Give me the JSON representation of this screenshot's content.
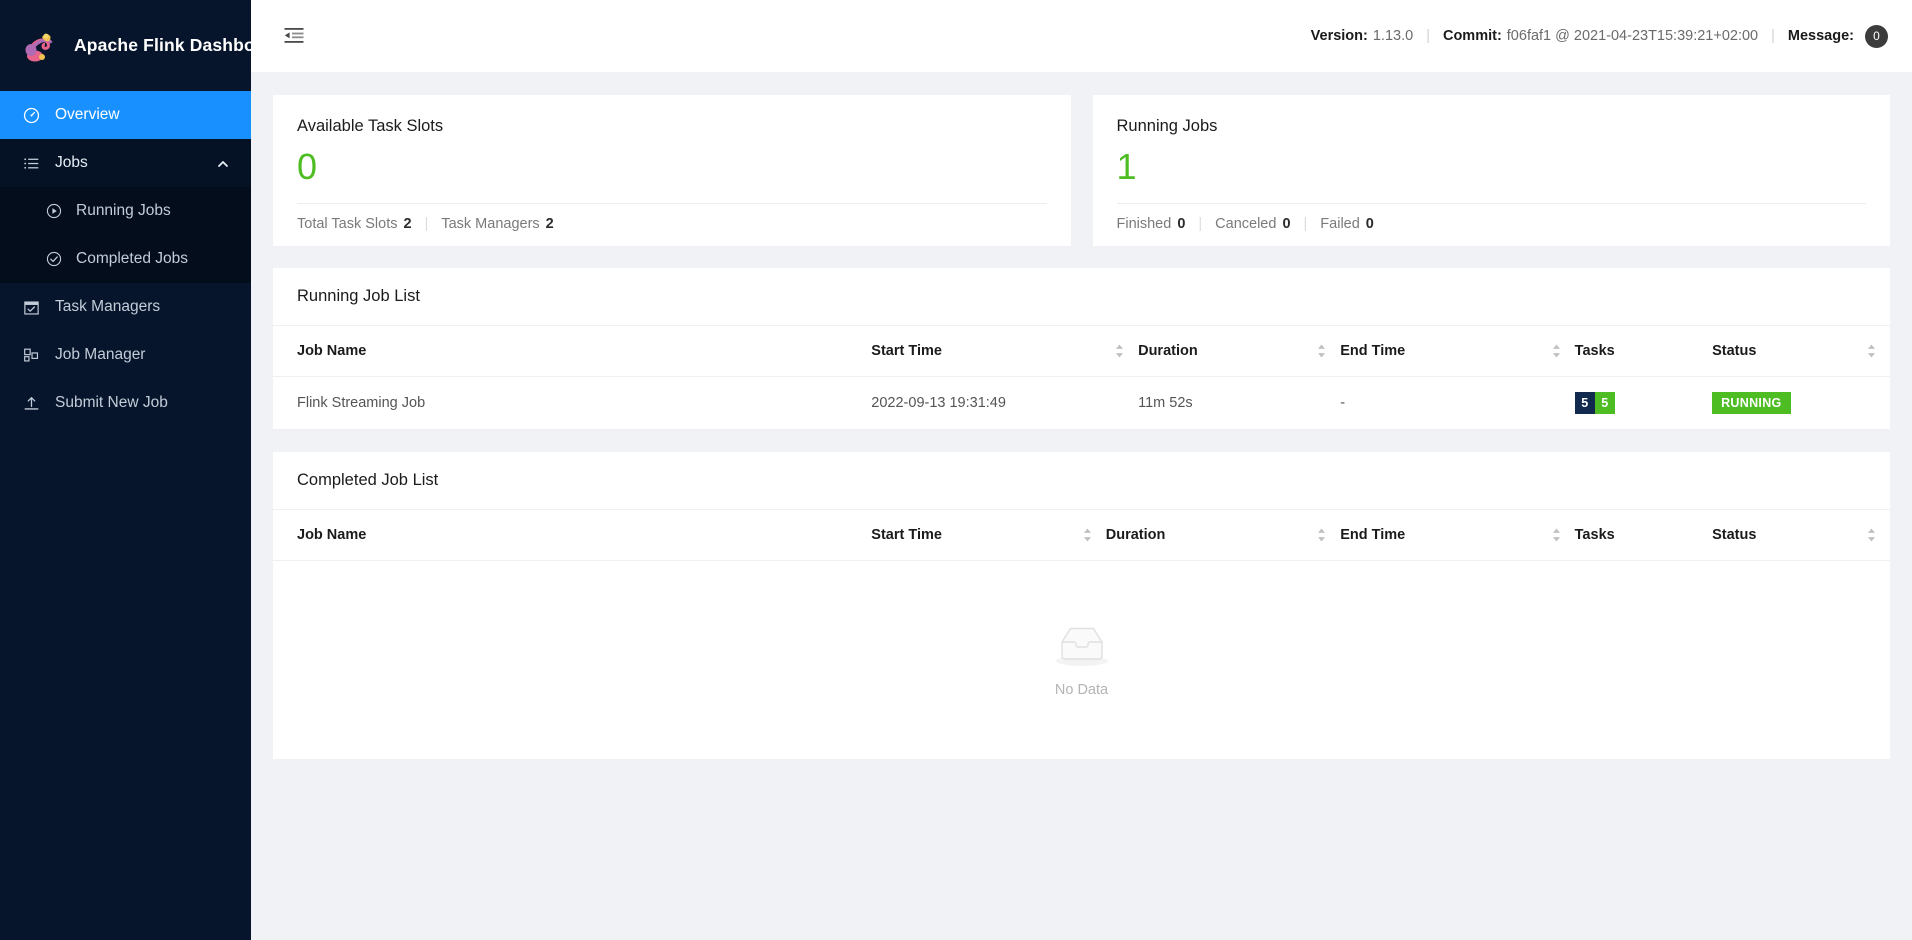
{
  "brand": {
    "title": "Apache Flink Dashboard",
    "logo_icon": "flink-squirrel-logo"
  },
  "sidebar": {
    "items": [
      {
        "label": "Overview",
        "icon": "dashboard-gauge-icon",
        "active": true
      },
      {
        "label": "Jobs",
        "icon": "list-icon",
        "expanded": true,
        "chevron": "chevron-up-icon"
      },
      {
        "label": "Task Managers",
        "icon": "calendar-check-icon",
        "active": false
      },
      {
        "label": "Job Manager",
        "icon": "cluster-grid-icon",
        "active": false
      },
      {
        "label": "Submit New Job",
        "icon": "upload-icon",
        "active": false
      }
    ],
    "sub_items": [
      {
        "label": "Running Jobs",
        "icon": "play-circle-icon"
      },
      {
        "label": "Completed Jobs",
        "icon": "check-circle-icon"
      }
    ]
  },
  "topbar": {
    "fold_icon": "menu-fold-icon",
    "version_label": "Version:",
    "version_value": "1.13.0",
    "commit_label": "Commit:",
    "commit_value": "f06faf1 @ 2021-04-23T15:39:21+02:00",
    "message_label": "Message:",
    "message_count": "0"
  },
  "cards": [
    {
      "title": "Available Task Slots",
      "value": "0",
      "footer": [
        {
          "label": "Total Task Slots",
          "value": "2"
        },
        {
          "label": "Task Managers",
          "value": "2"
        }
      ]
    },
    {
      "title": "Running Jobs",
      "value": "1",
      "footer": [
        {
          "label": "Finished",
          "value": "0"
        },
        {
          "label": "Canceled",
          "value": "0"
        },
        {
          "label": "Failed",
          "value": "0"
        }
      ]
    }
  ],
  "running_panel": {
    "title": "Running Job List",
    "columns": [
      {
        "label": "Job Name",
        "sortable": false
      },
      {
        "label": "Start Time",
        "sortable": true
      },
      {
        "label": "Duration",
        "sortable": true
      },
      {
        "label": "End Time",
        "sortable": true
      },
      {
        "label": "Tasks",
        "sortable": false
      },
      {
        "label": "Status",
        "sortable": true
      }
    ],
    "rows": [
      {
        "job_name": "Flink Streaming Job",
        "start_time": "2022-09-13 19:31:49",
        "duration": "11m 52s",
        "end_time": "-",
        "tasks_total": "5",
        "tasks_running": "5",
        "status": "RUNNING"
      }
    ]
  },
  "completed_panel": {
    "title": "Completed Job List",
    "columns": [
      {
        "label": "Job Name",
        "sortable": false
      },
      {
        "label": "Start Time",
        "sortable": true
      },
      {
        "label": "Duration",
        "sortable": true
      },
      {
        "label": "End Time",
        "sortable": true
      },
      {
        "label": "Tasks",
        "sortable": false
      },
      {
        "label": "Status",
        "sortable": true
      }
    ],
    "empty_text": "No Data",
    "empty_icon": "empty-inbox-icon"
  },
  "colors": {
    "sidebar_bg": "#06152b",
    "submenu_bg": "#030d1c",
    "accent_blue": "#1890ff",
    "green": "#4dbd23",
    "navy_badge": "#112a4e",
    "content_bg": "#f0f2f5"
  }
}
